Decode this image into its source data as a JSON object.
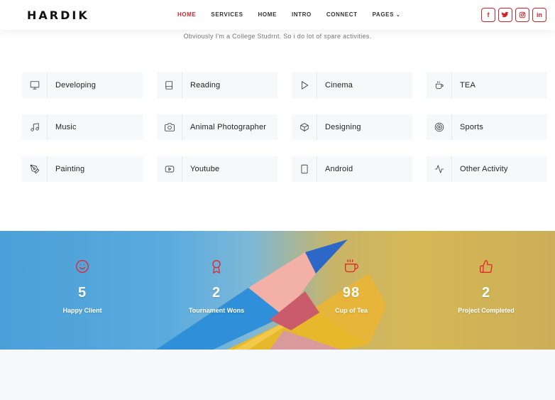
{
  "header": {
    "logo": "HARDIK",
    "nav": [
      "HOME",
      "SERVICES",
      "HOME",
      "INTRO",
      "CONNECT",
      "PAGES"
    ],
    "socials": [
      "f",
      "t",
      "ig",
      "in"
    ]
  },
  "subtitle": "Obviously I'm a College Studrnt. So i do lot of spare activities.",
  "activities": [
    {
      "label": "Developing",
      "icon": "monitor-icon"
    },
    {
      "label": "Reading",
      "icon": "book-icon"
    },
    {
      "label": "Cinema",
      "icon": "play-icon"
    },
    {
      "label": "TEA",
      "icon": "cup-icon"
    },
    {
      "label": "Music",
      "icon": "music-icon"
    },
    {
      "label": "Animal Photographer",
      "icon": "camera-icon"
    },
    {
      "label": "Designing",
      "icon": "box-icon"
    },
    {
      "label": "Sports",
      "icon": "target-icon"
    },
    {
      "label": "Painting",
      "icon": "pen-tool-icon"
    },
    {
      "label": "Youtube",
      "icon": "youtube-icon"
    },
    {
      "label": "Android",
      "icon": "tablet-icon"
    },
    {
      "label": "Other Activity",
      "icon": "activity-icon"
    }
  ],
  "stats": [
    {
      "value": "5",
      "caption": "Happy Client",
      "icon": "smile-icon"
    },
    {
      "value": "2",
      "caption": "Tournament Wons",
      "icon": "award-icon"
    },
    {
      "value": "98",
      "caption": "Cup of Tea",
      "icon": "coffee-icon"
    },
    {
      "value": "2",
      "caption": "Project Completed",
      "icon": "thumbs-up-icon"
    }
  ],
  "colors": {
    "accent": "#d8232a",
    "card_bg": "#f7f8fa"
  }
}
